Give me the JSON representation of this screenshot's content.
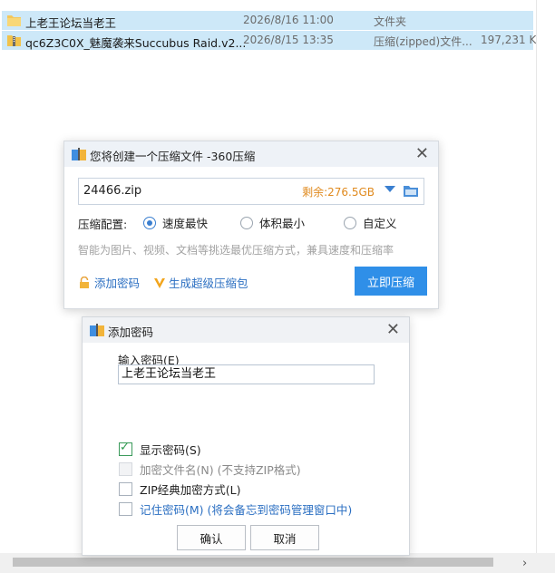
{
  "files": [
    {
      "name": "上老王论坛当老王",
      "date": "2026/8/16 11:00",
      "type": "文件夹",
      "size": "",
      "icon": "folder-icon"
    },
    {
      "name": "qc6Z3C0X_魅魔袭来Succubus Raid.v2...",
      "date": "2026/8/15 13:35",
      "type": "压缩(zipped)文件...",
      "size": "197,231 K",
      "icon": "zip-icon"
    }
  ],
  "compress_dialog": {
    "title": "您将创建一个压缩文件 -360压缩",
    "filename": "24466.zip",
    "free_space": "剩余:276.5GB",
    "config_label": "压缩配置:",
    "options": [
      {
        "label": "速度最快",
        "selected": true
      },
      {
        "label": "体积最小",
        "selected": false
      },
      {
        "label": "自定义",
        "selected": false
      }
    ],
    "hint": "智能为图片、视频、文档等挑选最优压缩方式，兼具速度和压缩率",
    "add_password": "添加密码",
    "super_pack": "生成超级压缩包",
    "compress_button": "立即压缩"
  },
  "password_dialog": {
    "title": "添加密码",
    "input_label": "输入密码(E)",
    "password_value": "上老王论坛当老王",
    "checkboxes": [
      {
        "label": "显示密码(S)",
        "checked": true,
        "disabled": false,
        "style": "normal"
      },
      {
        "label": "加密文件名(N) (不支持ZIP格式)",
        "checked": false,
        "disabled": true,
        "style": "disabled"
      },
      {
        "label": "ZIP经典加密方式(L)",
        "checked": false,
        "disabled": false,
        "style": "normal"
      },
      {
        "label": "记住密码(M) (将会备忘到密码管理窗口中)",
        "checked": false,
        "disabled": false,
        "style": "blue"
      }
    ],
    "ok_button": "确认",
    "cancel_button": "取消"
  },
  "colors": {
    "selection": "#cde8f8",
    "accent_blue": "#2f8fe8",
    "link_blue": "#2b6fc2",
    "free_space_orange": "#e08a1e"
  }
}
